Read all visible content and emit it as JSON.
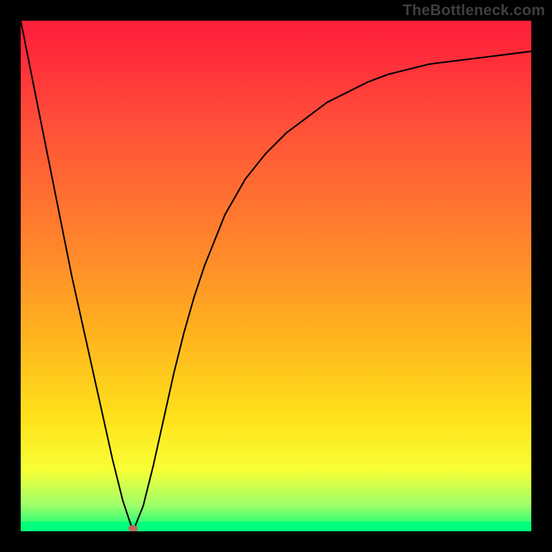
{
  "watermark": "TheBottleneck.com",
  "chart_data": {
    "type": "line",
    "title": "",
    "xlabel": "",
    "ylabel": "",
    "xlim": [
      0,
      100
    ],
    "ylim": [
      0,
      100
    ],
    "grid": false,
    "legend": null,
    "series": [
      {
        "name": "bottleneck-curve",
        "x": [
          0,
          2,
          4,
          6,
          8,
          10,
          12,
          14,
          16,
          18,
          20,
          22,
          24,
          26,
          28,
          30,
          32,
          34,
          36,
          38,
          40,
          44,
          48,
          52,
          56,
          60,
          64,
          68,
          72,
          76,
          80,
          84,
          88,
          92,
          96,
          100
        ],
        "y": [
          100,
          90,
          80,
          70,
          60,
          50,
          41,
          32,
          23,
          14,
          6,
          0,
          5,
          13,
          22,
          31,
          39,
          46,
          52,
          57,
          62,
          69,
          74,
          78,
          81,
          84,
          86,
          88,
          89.5,
          90.5,
          91.5,
          92,
          92.5,
          93,
          93.5,
          94
        ]
      }
    ],
    "annotations": [
      {
        "name": "min-marker",
        "x": 22,
        "y": 0,
        "shape": "dot",
        "color": "#b86a60"
      }
    ]
  },
  "colors": {
    "background": "#000000",
    "gradient_top": "#ff1f3a",
    "gradient_bottom": "#00ff7a",
    "curve": "#000000",
    "marker": "#b86a60",
    "watermark": "#3f3f3f"
  }
}
